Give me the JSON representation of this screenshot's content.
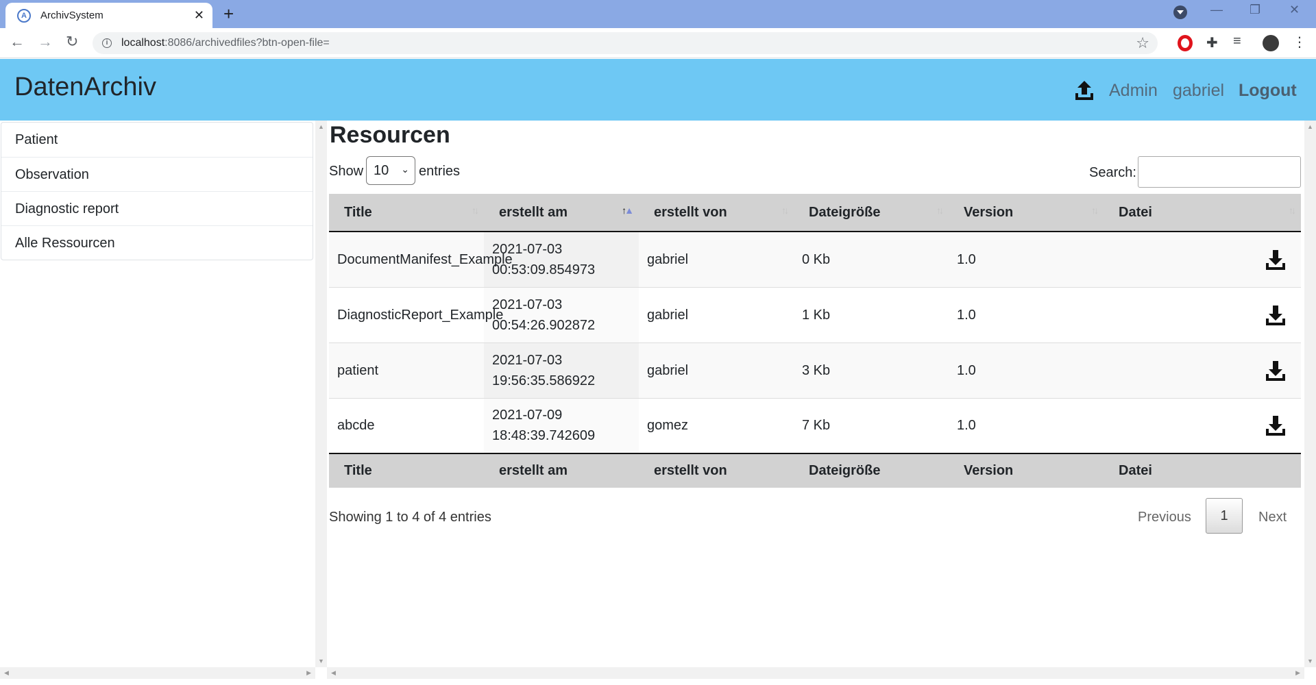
{
  "browser": {
    "tab_title": "ArchivSystem",
    "tab_icon": "archiv-favicon",
    "tab_icon_text": "A",
    "new_tab_symbol": "+",
    "url_host": "localhost",
    "url_rest": ":8086/archivedfiles?btn-open-file="
  },
  "header": {
    "brand": "DatenArchiv",
    "upload_icon": "upload-icon",
    "admin_label": "Admin",
    "user_label": "gabriel",
    "logout_label": "Logout",
    "background_color": "#6ec8f4"
  },
  "sidebar": {
    "items": [
      {
        "label": "Patient"
      },
      {
        "label": "Observation"
      },
      {
        "label": "Diagnostic report"
      },
      {
        "label": "Alle Ressourcen"
      }
    ]
  },
  "main": {
    "title": "Resourcen",
    "show_label": "Show",
    "page_length": "10",
    "entries_label": "entries",
    "search_label": "Search:",
    "search_value": "",
    "columns": [
      "Title",
      "erstellt am",
      "erstellt von",
      "Dateigröße",
      "Version",
      "Datei"
    ],
    "sorted_column": "erstellt am",
    "rows": [
      {
        "title": "DocumentManifest_Example",
        "date": "2021-07-03",
        "time": "00:53:09.854973",
        "author": "gabriel",
        "size": "0 Kb",
        "version": "1.0"
      },
      {
        "title": "DiagnosticReport_Example",
        "date": "2021-07-03",
        "time": "00:54:26.902872",
        "author": "gabriel",
        "size": "1 Kb",
        "version": "1.0"
      },
      {
        "title": "patient",
        "date": "2021-07-03",
        "time": "19:56:35.586922",
        "author": "gabriel",
        "size": "3 Kb",
        "version": "1.0"
      },
      {
        "title": "abcde",
        "date": "2021-07-09",
        "time": "18:48:39.742609",
        "author": "gomez",
        "size": "7 Kb",
        "version": "1.0"
      }
    ],
    "info": "Showing 1 to 4 of 4 entries",
    "pagination": {
      "previous": "Previous",
      "current": "1",
      "next": "Next"
    }
  }
}
